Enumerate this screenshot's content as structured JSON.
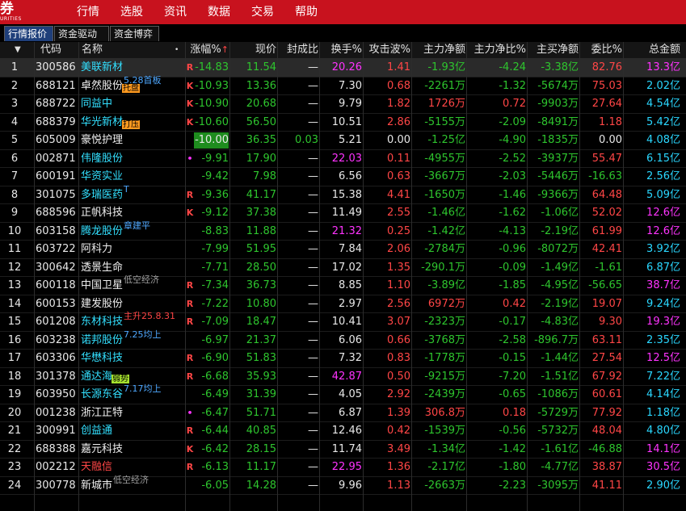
{
  "app": {
    "logo_text": "券",
    "logo_sub": "URITIES"
  },
  "menu": [
    "行情",
    "选股",
    "资讯",
    "数据",
    "交易",
    "帮助"
  ],
  "tabs": [
    "行情报价",
    "资金驱动力",
    "资金博弈"
  ],
  "columns": {
    "index": "",
    "code": "代码",
    "name": "名称",
    "change_pct": "涨幅%",
    "price": "现价",
    "seal_ratio": "封成比",
    "turnover": "换手%",
    "attack_wave": "攻击波%",
    "main_net": "主力净额",
    "main_net_pct": "主力净比%",
    "main_buy_net": "主买净额",
    "wei_ratio": "委比%",
    "total_amount": "总金额"
  },
  "sort_indicator": "↑",
  "rows": [
    {
      "idx": "1",
      "code": "300586",
      "name": "美联新材",
      "name_color": "namecyan",
      "tag": "",
      "tag_style": "",
      "flag": "R",
      "flag_color": "red",
      "chg": "-14.83",
      "price": "11.54",
      "seal": "—",
      "turn": "20.26",
      "turn_color": "magenta",
      "atk": "1.41",
      "atk_color": "red",
      "main": "-1.93亿",
      "main_color": "green",
      "mainpct": "-4.24",
      "mainpct_color": "green",
      "buy": "-3.38亿",
      "buy_color": "green",
      "wei": "82.76",
      "wei_color": "red",
      "amt": "13.3亿",
      "amt_color": "magenta",
      "selected": true
    },
    {
      "idx": "2",
      "code": "688121",
      "name": "卓然股份",
      "name_color": "namewhite",
      "tag": "5.28首板",
      "tag_style": "blue",
      "tag2": "托盘",
      "tag2_style": "box orange",
      "flag": "K",
      "flag_color": "red",
      "chg": "-10.93",
      "price": "13.36",
      "seal": "—",
      "turn": "7.30",
      "turn_color": "white",
      "atk": "0.68",
      "atk_color": "red",
      "main": "-2261万",
      "main_color": "green",
      "mainpct": "-1.32",
      "mainpct_color": "green",
      "buy": "-5674万",
      "buy_color": "green",
      "wei": "75.03",
      "wei_color": "red",
      "amt": "2.02亿",
      "amt_color": "cyan"
    },
    {
      "idx": "3",
      "code": "688722",
      "name": "同益中",
      "name_color": "namecyan",
      "tag": "",
      "tag_style": "",
      "flag": "K",
      "flag_color": "red",
      "chg": "-10.90",
      "price": "20.68",
      "seal": "—",
      "turn": "9.79",
      "turn_color": "white",
      "atk": "1.82",
      "atk_color": "red",
      "main": "1726万",
      "main_color": "red",
      "mainpct": "0.72",
      "mainpct_color": "red",
      "buy": "-9903万",
      "buy_color": "green",
      "wei": "27.64",
      "wei_color": "red",
      "amt": "4.54亿",
      "amt_color": "cyan"
    },
    {
      "idx": "4",
      "code": "688379",
      "name": "华光新材",
      "name_color": "namecyan",
      "tag": "",
      "tag_style": "",
      "tag2": "打压",
      "tag2_style": "box orange",
      "flag": "K",
      "flag_color": "red",
      "chg": "-10.60",
      "price": "56.50",
      "seal": "—",
      "turn": "10.51",
      "turn_color": "white",
      "atk": "2.86",
      "atk_color": "red",
      "main": "-5155万",
      "main_color": "green",
      "mainpct": "-2.09",
      "mainpct_color": "green",
      "buy": "-8491万",
      "buy_color": "green",
      "wei": "1.18",
      "wei_color": "red",
      "amt": "5.42亿",
      "amt_color": "cyan"
    },
    {
      "idx": "5",
      "code": "605009",
      "name": "豪悦护理",
      "name_color": "namewhite",
      "tag": "",
      "tag_style": "",
      "flag": "",
      "flag_color": "",
      "chg": "-10.00",
      "price": "36.35",
      "seal": "0.03",
      "turn": "5.21",
      "turn_color": "white",
      "atk": "0.00",
      "atk_color": "white",
      "main": "-1.25亿",
      "main_color": "green",
      "mainpct": "-4.90",
      "mainpct_color": "green",
      "buy": "-1835万",
      "buy_color": "green",
      "wei": "0.00",
      "wei_color": "white",
      "amt": "4.08亿",
      "amt_color": "cyan",
      "limit": true
    },
    {
      "idx": "6",
      "code": "002871",
      "name": "伟隆股份",
      "name_color": "namecyan",
      "tag": "",
      "tag_style": "",
      "flag": "•",
      "flag_color": "magenta",
      "chg": "-9.91",
      "price": "17.90",
      "seal": "—",
      "turn": "22.03",
      "turn_color": "magenta",
      "atk": "0.11",
      "atk_color": "red",
      "main": "-4955万",
      "main_color": "green",
      "mainpct": "-2.52",
      "mainpct_color": "green",
      "buy": "-3937万",
      "buy_color": "green",
      "wei": "55.47",
      "wei_color": "red",
      "amt": "6.15亿",
      "amt_color": "cyan"
    },
    {
      "idx": "7",
      "code": "600191",
      "name": "华资实业",
      "name_color": "namecyan",
      "tag": "",
      "tag_style": "",
      "flag": "",
      "flag_color": "",
      "chg": "-9.42",
      "price": "7.98",
      "seal": "—",
      "turn": "6.56",
      "turn_color": "white",
      "atk": "0.63",
      "atk_color": "red",
      "main": "-3667万",
      "main_color": "green",
      "mainpct": "-2.03",
      "mainpct_color": "green",
      "buy": "-5446万",
      "buy_color": "green",
      "wei": "-16.63",
      "wei_color": "green",
      "amt": "2.56亿",
      "amt_color": "cyan"
    },
    {
      "idx": "8",
      "code": "301075",
      "name": "多瑞医药",
      "name_color": "namecyan",
      "tag": "T",
      "tag_style": "blue",
      "flag": "R",
      "flag_color": "red",
      "chg": "-9.36",
      "price": "41.17",
      "seal": "—",
      "turn": "15.38",
      "turn_color": "white",
      "atk": "4.41",
      "atk_color": "red",
      "main": "-1650万",
      "main_color": "green",
      "mainpct": "-1.46",
      "mainpct_color": "green",
      "buy": "-9366万",
      "buy_color": "green",
      "wei": "64.48",
      "wei_color": "red",
      "amt": "5.09亿",
      "amt_color": "cyan"
    },
    {
      "idx": "9",
      "code": "688596",
      "name": "正帆科技",
      "name_color": "namewhite",
      "tag": "",
      "tag_style": "",
      "flag": "K",
      "flag_color": "red",
      "chg": "-9.12",
      "price": "37.38",
      "seal": "—",
      "turn": "11.49",
      "turn_color": "white",
      "atk": "2.55",
      "atk_color": "red",
      "main": "-1.46亿",
      "main_color": "green",
      "mainpct": "-1.62",
      "mainpct_color": "green",
      "buy": "-1.06亿",
      "buy_color": "green",
      "wei": "52.02",
      "wei_color": "red",
      "amt": "12.6亿",
      "amt_color": "magenta"
    },
    {
      "idx": "10",
      "code": "603158",
      "name": "腾龙股份",
      "name_color": "namecyan",
      "tag": "章建平",
      "tag_style": "blue",
      "flag": "",
      "flag_color": "",
      "chg": "-8.83",
      "price": "11.88",
      "seal": "—",
      "turn": "21.32",
      "turn_color": "magenta",
      "atk": "0.25",
      "atk_color": "red",
      "main": "-1.42亿",
      "main_color": "green",
      "mainpct": "-4.13",
      "mainpct_color": "green",
      "buy": "-2.19亿",
      "buy_color": "green",
      "wei": "61.99",
      "wei_color": "red",
      "amt": "12.6亿",
      "amt_color": "magenta"
    },
    {
      "idx": "11",
      "code": "603722",
      "name": "阿科力",
      "name_color": "namewhite",
      "tag": "",
      "tag_style": "",
      "flag": "",
      "flag_color": "",
      "chg": "-7.99",
      "price": "51.95",
      "seal": "—",
      "turn": "7.84",
      "turn_color": "white",
      "atk": "2.06",
      "atk_color": "red",
      "main": "-2784万",
      "main_color": "green",
      "mainpct": "-0.96",
      "mainpct_color": "green",
      "buy": "-8072万",
      "buy_color": "green",
      "wei": "42.41",
      "wei_color": "red",
      "amt": "3.92亿",
      "amt_color": "cyan"
    },
    {
      "idx": "12",
      "code": "300642",
      "name": "透景生命",
      "name_color": "namewhite",
      "tag": "",
      "tag_style": "",
      "flag": "",
      "flag_color": "",
      "chg": "-7.71",
      "price": "28.50",
      "seal": "—",
      "turn": "17.02",
      "turn_color": "white",
      "atk": "1.35",
      "atk_color": "red",
      "main": "-290.1万",
      "main_color": "green",
      "mainpct": "-0.09",
      "mainpct_color": "green",
      "buy": "-1.49亿",
      "buy_color": "green",
      "wei": "-1.61",
      "wei_color": "green",
      "amt": "6.87亿",
      "amt_color": "cyan"
    },
    {
      "idx": "13",
      "code": "600118",
      "name": "中国卫星",
      "name_color": "namewhite",
      "tag": "低空经济",
      "tag_style": "gray",
      "flag": "R",
      "flag_color": "red",
      "chg": "-7.34",
      "price": "36.73",
      "seal": "—",
      "turn": "8.85",
      "turn_color": "white",
      "atk": "1.10",
      "atk_color": "red",
      "main": "-3.89亿",
      "main_color": "green",
      "mainpct": "-1.85",
      "mainpct_color": "green",
      "buy": "-4.95亿",
      "buy_color": "green",
      "wei": "-56.65",
      "wei_color": "green",
      "amt": "38.7亿",
      "amt_color": "magenta"
    },
    {
      "idx": "14",
      "code": "600153",
      "name": "建发股份",
      "name_color": "namewhite",
      "tag": "",
      "tag_style": "",
      "flag": "R",
      "flag_color": "red",
      "chg": "-7.22",
      "price": "10.80",
      "seal": "—",
      "turn": "2.97",
      "turn_color": "white",
      "atk": "2.56",
      "atk_color": "red",
      "main": "6972万",
      "main_color": "red",
      "mainpct": "0.42",
      "mainpct_color": "red",
      "buy": "-2.19亿",
      "buy_color": "green",
      "wei": "19.07",
      "wei_color": "red",
      "amt": "9.24亿",
      "amt_color": "cyan"
    },
    {
      "idx": "15",
      "code": "601208",
      "name": "东材科技",
      "name_color": "namecyan",
      "tag": "主升25.8.31",
      "tag_style": "red",
      "flag": "R",
      "flag_color": "red",
      "chg": "-7.09",
      "price": "18.47",
      "seal": "—",
      "turn": "10.41",
      "turn_color": "white",
      "atk": "3.07",
      "atk_color": "red",
      "main": "-2323万",
      "main_color": "green",
      "mainpct": "-0.17",
      "mainpct_color": "green",
      "buy": "-4.83亿",
      "buy_color": "green",
      "wei": "9.30",
      "wei_color": "red",
      "amt": "19.3亿",
      "amt_color": "magenta"
    },
    {
      "idx": "16",
      "code": "603238",
      "name": "诺邦股份",
      "name_color": "namecyan",
      "tag": "7.25均上",
      "tag_style": "blue",
      "flag": "",
      "flag_color": "",
      "chg": "-6.97",
      "price": "21.37",
      "seal": "—",
      "turn": "6.06",
      "turn_color": "white",
      "atk": "0.66",
      "atk_color": "red",
      "main": "-3768万",
      "main_color": "green",
      "mainpct": "-2.58",
      "mainpct_color": "green",
      "buy": "-896.7万",
      "buy_color": "green",
      "wei": "63.11",
      "wei_color": "red",
      "amt": "2.35亿",
      "amt_color": "cyan"
    },
    {
      "idx": "17",
      "code": "603306",
      "name": "华懋科技",
      "name_color": "namecyan",
      "tag": "",
      "tag_style": "",
      "flag": "R",
      "flag_color": "red",
      "chg": "-6.90",
      "price": "51.83",
      "seal": "—",
      "turn": "7.32",
      "turn_color": "white",
      "atk": "0.83",
      "atk_color": "red",
      "main": "-1778万",
      "main_color": "green",
      "mainpct": "-0.15",
      "mainpct_color": "green",
      "buy": "-1.44亿",
      "buy_color": "green",
      "wei": "27.54",
      "wei_color": "red",
      "amt": "12.5亿",
      "amt_color": "magenta"
    },
    {
      "idx": "18",
      "code": "301378",
      "name": "通达海",
      "name_color": "namecyan",
      "tag": "",
      "tag_style": "",
      "tag2": "弱势",
      "tag2_style": "box lime",
      "flag": "R",
      "flag_color": "red",
      "chg": "-6.68",
      "price": "35.93",
      "seal": "—",
      "turn": "42.87",
      "turn_color": "magenta",
      "atk": "0.50",
      "atk_color": "red",
      "main": "-9215万",
      "main_color": "green",
      "mainpct": "-7.20",
      "mainpct_color": "green",
      "buy": "-1.51亿",
      "buy_color": "green",
      "wei": "67.92",
      "wei_color": "red",
      "amt": "7.22亿",
      "amt_color": "cyan"
    },
    {
      "idx": "19",
      "code": "603950",
      "name": "长源东谷",
      "name_color": "namecyan",
      "tag": "7.17均上",
      "tag_style": "blue",
      "flag": "",
      "flag_color": "",
      "chg": "-6.49",
      "price": "31.39",
      "seal": "—",
      "turn": "4.05",
      "turn_color": "white",
      "atk": "2.92",
      "atk_color": "red",
      "main": "-2439万",
      "main_color": "green",
      "mainpct": "-0.65",
      "mainpct_color": "green",
      "buy": "-1086万",
      "buy_color": "green",
      "wei": "60.61",
      "wei_color": "red",
      "amt": "4.14亿",
      "amt_color": "cyan"
    },
    {
      "idx": "20",
      "code": "001238",
      "name": "浙江正特",
      "name_color": "namewhite",
      "tag": "",
      "tag_style": "",
      "flag": "•",
      "flag_color": "magenta",
      "chg": "-6.47",
      "price": "51.71",
      "seal": "—",
      "turn": "6.87",
      "turn_color": "white",
      "atk": "1.39",
      "atk_color": "red",
      "main": "306.8万",
      "main_color": "red",
      "mainpct": "0.18",
      "mainpct_color": "red",
      "buy": "-5729万",
      "buy_color": "green",
      "wei": "77.92",
      "wei_color": "red",
      "amt": "1.18亿",
      "amt_color": "cyan"
    },
    {
      "idx": "21",
      "code": "300991",
      "name": "创益通",
      "name_color": "namecyan",
      "tag": "",
      "tag_style": "",
      "flag": "R",
      "flag_color": "red",
      "chg": "-6.44",
      "price": "40.85",
      "seal": "—",
      "turn": "12.46",
      "turn_color": "white",
      "atk": "0.42",
      "atk_color": "red",
      "main": "-1539万",
      "main_color": "green",
      "mainpct": "-0.56",
      "mainpct_color": "green",
      "buy": "-5732万",
      "buy_color": "green",
      "wei": "48.04",
      "wei_color": "red",
      "amt": "4.80亿",
      "amt_color": "cyan"
    },
    {
      "idx": "22",
      "code": "688388",
      "name": "嘉元科技",
      "name_color": "namewhite",
      "tag": "",
      "tag_style": "",
      "flag": "K",
      "flag_color": "red",
      "chg": "-6.42",
      "price": "28.15",
      "seal": "—",
      "turn": "11.74",
      "turn_color": "white",
      "atk": "3.49",
      "atk_color": "red",
      "main": "-1.34亿",
      "main_color": "green",
      "mainpct": "-1.42",
      "mainpct_color": "green",
      "buy": "-1.61亿",
      "buy_color": "green",
      "wei": "-46.88",
      "wei_color": "green",
      "amt": "14.1亿",
      "amt_color": "magenta"
    },
    {
      "idx": "23",
      "code": "002212",
      "name": "天融信",
      "name_color": "red",
      "tag": "",
      "tag_style": "",
      "flag": "R",
      "flag_color": "red",
      "chg": "-6.13",
      "price": "11.17",
      "seal": "—",
      "turn": "22.95",
      "turn_color": "magenta",
      "atk": "1.36",
      "atk_color": "red",
      "main": "-2.17亿",
      "main_color": "green",
      "mainpct": "-1.80",
      "mainpct_color": "green",
      "buy": "-4.77亿",
      "buy_color": "green",
      "wei": "38.87",
      "wei_color": "red",
      "amt": "30.5亿",
      "amt_color": "magenta"
    },
    {
      "idx": "24",
      "code": "300778",
      "name": "新城市",
      "name_color": "namewhite",
      "tag": "低空经济",
      "tag_style": "gray",
      "flag": "",
      "flag_color": "",
      "chg": "-6.05",
      "price": "14.28",
      "seal": "—",
      "turn": "9.96",
      "turn_color": "white",
      "atk": "1.13",
      "atk_color": "red",
      "main": "-2663万",
      "main_color": "green",
      "mainpct": "-2.23",
      "mainpct_color": "green",
      "buy": "-3095万",
      "buy_color": "green",
      "wei": "41.11",
      "wei_color": "red",
      "amt": "2.90亿",
      "amt_color": "cyan"
    }
  ]
}
